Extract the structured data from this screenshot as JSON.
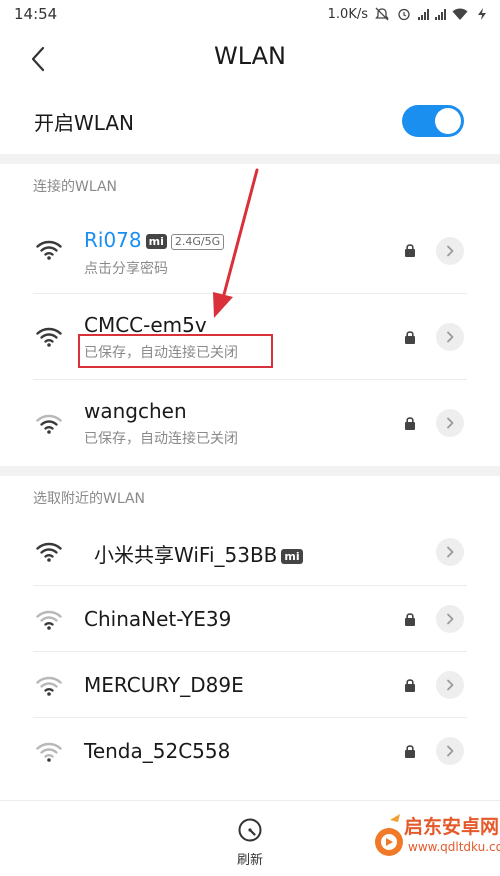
{
  "status_bar": {
    "time": "14:54",
    "net_speed": "1.0K/s"
  },
  "header": {
    "title": "WLAN",
    "back_icon": "chevron-left-icon"
  },
  "wlan_toggle": {
    "label": "开启WLAN",
    "state": "on",
    "accent_color": "#1a8ff0"
  },
  "connected_section": {
    "label": "连接的WLAN",
    "networks": [
      {
        "name": "Ri078",
        "badge": "mi",
        "band": "2.4G/5G",
        "status": "点击分享密码",
        "locked": true,
        "active": true,
        "name_color": "#1a8ff0"
      },
      {
        "name": "CMCC-em5v",
        "status": "已保存，自动连接已关闭",
        "locked": true
      },
      {
        "name": "wangchen",
        "status": "已保存，自动连接已关闭",
        "locked": true
      }
    ]
  },
  "nearby_section": {
    "label": "选取附近的WLAN",
    "networks": [
      {
        "name": "小米共享WiFi_53BB",
        "badge": "mi",
        "locked": false
      },
      {
        "name": "ChinaNet-YE39",
        "locked": true
      },
      {
        "name": "MERCURY_D89E",
        "locked": true
      },
      {
        "name": "Tenda_52C558",
        "locked": true
      }
    ]
  },
  "bottom_bar": {
    "refresh_label": "刷新"
  },
  "annotation": {
    "highlight_color": "#d9303a"
  },
  "watermark": {
    "text": "启东安卓网",
    "url": "www.qdltdku.com"
  }
}
